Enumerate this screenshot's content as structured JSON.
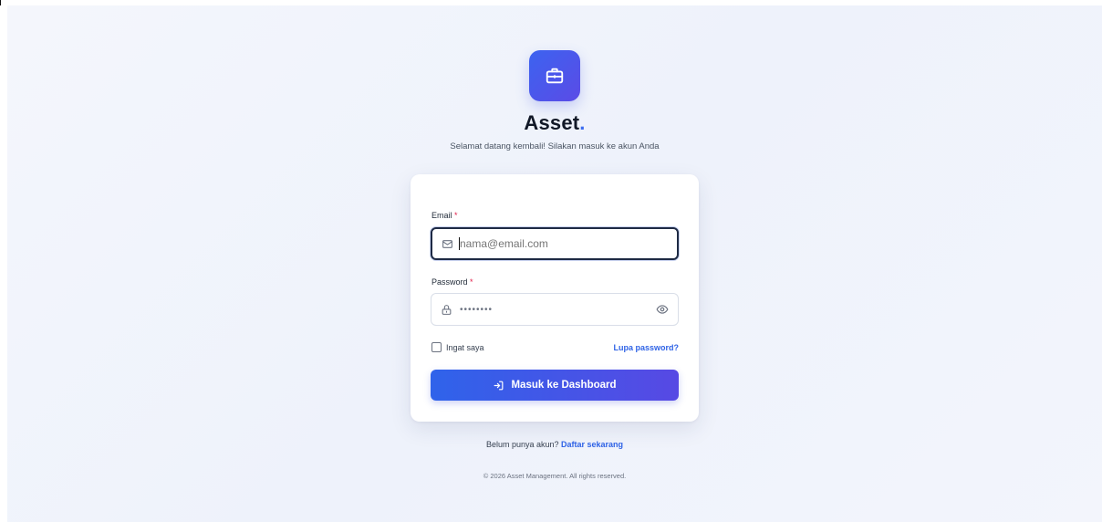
{
  "brand": {
    "name": "Asset",
    "name_dot": ".",
    "subtitle": "Selamat datang kembali! Silakan masuk ke akun Anda",
    "logo_icon": "briefcase-icon",
    "accent_color": "#3b6cf0"
  },
  "form": {
    "email_label": "Email",
    "email_required": "*",
    "email_placeholder": "nama@email.com",
    "password_label": "Password",
    "password_required": "*",
    "password_masked": "••••••••",
    "remember_label": "Ingat saya",
    "remember_checked": false,
    "forgot_link": "Lupa password?",
    "submit_label": "Masuk ke Dashboard"
  },
  "signup": {
    "prompt": "Belum punya akun?",
    "link": "Daftar sekarang"
  },
  "footer": {
    "copyright": "© 2026 Asset Management. All rights reserved."
  }
}
